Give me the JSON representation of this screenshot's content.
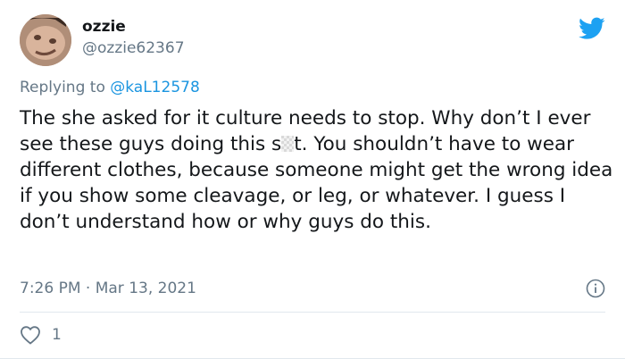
{
  "author": {
    "name": "ozzie",
    "handle": "@ozzie62367",
    "avatar_icon": "profile-photo"
  },
  "reply": {
    "prefix": "Replying to",
    "handle": "@kaL12578"
  },
  "tweet": {
    "text_part1": "The she asked for it culture needs to stop. Why don’t I ever see these guys doing this s",
    "text_part2": "t. You shouldn’t have to wear different clothes, because someone might get the wrong idea if you show some cleavage, or leg, or whatever. I guess I don’t understand how or why guys do this."
  },
  "meta": {
    "time": "7:26 PM",
    "separator": "·",
    "date": "Mar 13, 2021"
  },
  "actions": {
    "like_count": "1"
  },
  "colors": {
    "brand": "#1da1f2",
    "link": "#1b95e0",
    "secondary_text": "#657786",
    "primary_text": "#14171a"
  },
  "icons": {
    "platform": "twitter-bird-icon",
    "info": "info-icon",
    "like": "heart-icon"
  }
}
